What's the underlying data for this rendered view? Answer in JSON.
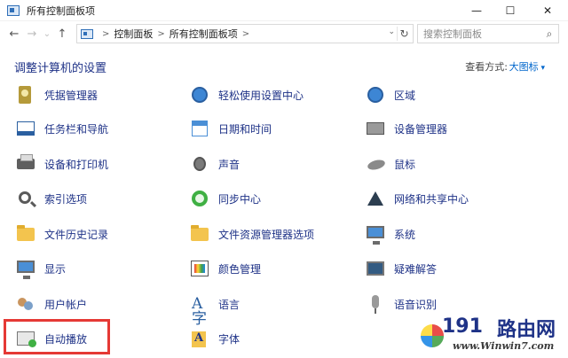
{
  "window": {
    "title": "所有控制面板项",
    "minimize": "—",
    "maximize": "☐",
    "close": "✕"
  },
  "nav": {
    "back": "←",
    "forward": "→",
    "down": "⌄",
    "up": "↑",
    "breadcrumb": [
      "控制面板",
      "所有控制面板项"
    ],
    "refresh": "↻",
    "dropdown": "⌄"
  },
  "search": {
    "placeholder": "搜索控制面板",
    "icon": "⌕"
  },
  "header": {
    "title": "调整计算机的设置",
    "view_by_label": "查看方式:",
    "view_by_value": "大图标"
  },
  "items": [
    {
      "label": "凭据管理器",
      "icon": "credential-manager-icon"
    },
    {
      "label": "轻松使用设置中心",
      "icon": "ease-of-access-icon"
    },
    {
      "label": "区域",
      "icon": "region-icon"
    },
    {
      "label": "任务栏和导航",
      "icon": "taskbar-icon"
    },
    {
      "label": "日期和时间",
      "icon": "date-time-icon"
    },
    {
      "label": "设备管理器",
      "icon": "device-manager-icon"
    },
    {
      "label": "设备和打印机",
      "icon": "printer-icon"
    },
    {
      "label": "声音",
      "icon": "speaker-icon"
    },
    {
      "label": "鼠标",
      "icon": "mouse-icon"
    },
    {
      "label": "索引选项",
      "icon": "indexing-icon"
    },
    {
      "label": "同步中心",
      "icon": "sync-center-icon"
    },
    {
      "label": "网络和共享中心",
      "icon": "network-icon"
    },
    {
      "label": "文件历史记录",
      "icon": "file-history-icon"
    },
    {
      "label": "文件资源管理器选项",
      "icon": "folder-options-icon"
    },
    {
      "label": "系统",
      "icon": "system-icon"
    },
    {
      "label": "显示",
      "icon": "display-icon"
    },
    {
      "label": "颜色管理",
      "icon": "color-management-icon"
    },
    {
      "label": "疑难解答",
      "icon": "troubleshooting-icon"
    },
    {
      "label": "用户帐户",
      "icon": "user-accounts-icon"
    },
    {
      "label": "语言",
      "icon": "language-icon"
    },
    {
      "label": "语音识别",
      "icon": "speech-recognition-icon"
    },
    {
      "label": "自动播放",
      "icon": "autoplay-icon"
    },
    {
      "label": "字体",
      "icon": "fonts-icon"
    }
  ],
  "watermark": {
    "number": "191",
    "text": "路由网",
    "url": "www.Winwin7.com"
  },
  "colors": {
    "link_text": "#1e3287",
    "accent_blue": "#0066cc",
    "highlight_red": "#e53935"
  }
}
